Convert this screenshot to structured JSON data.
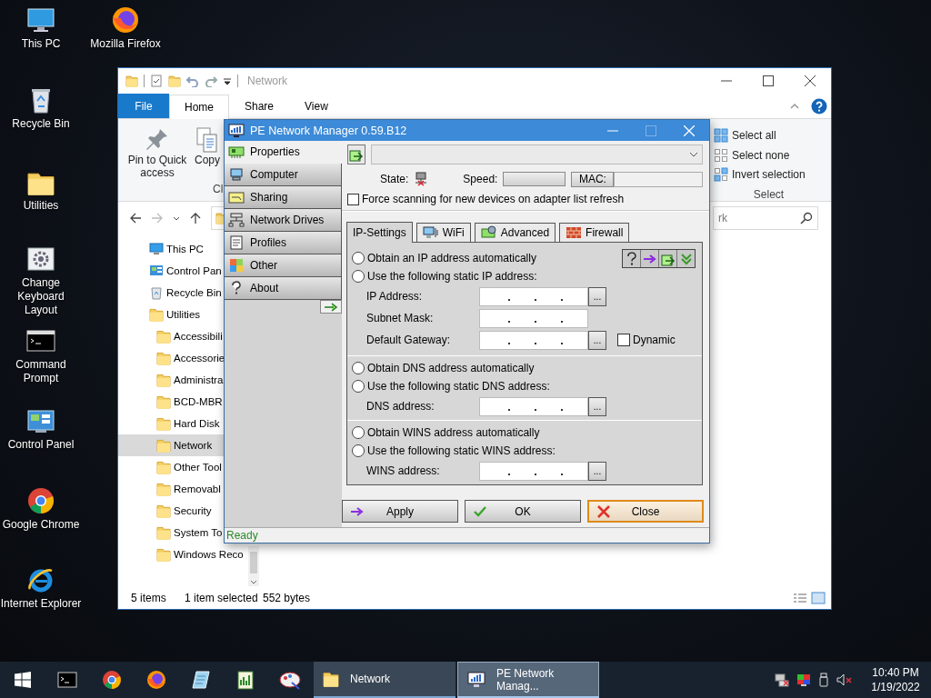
{
  "desktop": {
    "icons": [
      {
        "label": "This PC",
        "kind": "pc"
      },
      {
        "label": "Mozilla Firefox",
        "kind": "firefox"
      },
      {
        "label": "Recycle Bin",
        "kind": "recycle"
      },
      {
        "label": "Utilities",
        "kind": "folder"
      },
      {
        "label": "Change Keyboard Layout",
        "kind": "keyboard"
      },
      {
        "label": "Command Prompt",
        "kind": "cmd"
      },
      {
        "label": "Control Panel",
        "kind": "control"
      },
      {
        "label": "Google Chrome",
        "kind": "chrome"
      },
      {
        "label": "Internet Explorer",
        "kind": "ie"
      }
    ]
  },
  "explorer": {
    "title": "Network",
    "ribbon_tabs": [
      {
        "label": "File",
        "kind": "file",
        "selected": false
      },
      {
        "label": "Home",
        "kind": "tab",
        "selected": true
      },
      {
        "label": "Share",
        "kind": "tab",
        "selected": false
      },
      {
        "label": "View",
        "kind": "tab",
        "selected": false
      }
    ],
    "clipboard_commands": [
      {
        "label": "Pin to Quick access",
        "kind": "pin"
      },
      {
        "label": "Copy",
        "kind": "copy"
      }
    ],
    "clipboard_group": "Cl",
    "select_commands": [
      {
        "label": "Select all",
        "kind": "all"
      },
      {
        "label": "Select none",
        "kind": "none"
      },
      {
        "label": "Invert selection",
        "kind": "invert"
      }
    ],
    "select_group": "Select",
    "search": {
      "placeholder": "rk"
    },
    "nav_tree": [
      {
        "label": "This PC",
        "kind": "pc",
        "selected": false
      },
      {
        "label": "Control Pan",
        "kind": "control",
        "selected": false
      },
      {
        "label": "Recycle Bin",
        "kind": "recycle",
        "selected": false
      },
      {
        "label": "Utilities",
        "kind": "folder",
        "selected": false,
        "children": [
          {
            "label": "Accessibili",
            "kind": "folder",
            "selected": false
          },
          {
            "label": "Accessorie",
            "kind": "folder",
            "selected": false
          },
          {
            "label": "Administra",
            "kind": "folder",
            "selected": false
          },
          {
            "label": "BCD-MBR",
            "kind": "folder",
            "selected": false
          },
          {
            "label": "Hard Disk",
            "kind": "folder",
            "selected": false
          },
          {
            "label": "Network",
            "kind": "folder",
            "selected": true
          },
          {
            "label": "Other Tool",
            "kind": "folder",
            "selected": false
          },
          {
            "label": "Removabl",
            "kind": "folder",
            "selected": false
          },
          {
            "label": "Security",
            "kind": "folder",
            "selected": false
          },
          {
            "label": "System To",
            "kind": "folder",
            "selected": false
          },
          {
            "label": "Windows Reco",
            "kind": "folder",
            "selected": false
          }
        ]
      }
    ],
    "status": [
      "5 items",
      "1 item selected",
      "552 bytes"
    ]
  },
  "dialog": {
    "title": "PE Network Manager 0.59.B12",
    "sidebar": [
      {
        "label": "Properties",
        "kind": "properties",
        "selected": true
      },
      {
        "label": "Computer",
        "kind": "computer",
        "selected": false
      },
      {
        "label": "Sharing",
        "kind": "sharing",
        "selected": false
      },
      {
        "label": "Network Drives",
        "kind": "drives",
        "selected": false
      },
      {
        "label": "Profiles",
        "kind": "profiles",
        "selected": false
      },
      {
        "label": "Other",
        "kind": "other",
        "selected": false
      },
      {
        "label": "About",
        "kind": "about",
        "selected": false
      }
    ],
    "state_label": "State:",
    "speed_label": "Speed:",
    "mac_label": "MAC:",
    "force_scan": {
      "label": "Force scanning for new devices on adapter list refresh",
      "checked": false
    },
    "tabs": [
      {
        "label": "IP-Settings",
        "kind": "plain",
        "selected": true
      },
      {
        "label": "WiFi",
        "kind": "wifi",
        "selected": false
      },
      {
        "label": "Advanced",
        "kind": "advanced",
        "selected": false
      },
      {
        "label": "Firewall",
        "kind": "firewall",
        "selected": false
      }
    ],
    "sections": [
      {
        "radios": [
          {
            "label": "Obtain an IP address automatically",
            "selected": false
          },
          {
            "label": "Use the following static IP address:",
            "selected": false
          }
        ],
        "fields": [
          {
            "label": "IP Address:",
            "browse": "..."
          },
          {
            "label": "Subnet Mask:"
          },
          {
            "label": "Default Gateway:",
            "browse": "...",
            "option": {
              "label": "Dynamic",
              "checked": false
            }
          }
        ]
      },
      {
        "radios": [
          {
            "label": "Obtain DNS address automatically",
            "selected": false
          },
          {
            "label": "Use the following static DNS address:",
            "selected": false
          }
        ],
        "fields": [
          {
            "label": "DNS address:",
            "browse": "..."
          }
        ]
      },
      {
        "radios": [
          {
            "label": "Obtain WINS address automatically",
            "selected": false
          },
          {
            "label": "Use the following static WINS address:",
            "selected": false
          }
        ],
        "fields": [
          {
            "label": "WINS address:",
            "browse": "..."
          }
        ]
      }
    ],
    "buttons": [
      {
        "label": "Apply",
        "kind": "apply",
        "default": false
      },
      {
        "label": "OK",
        "kind": "ok",
        "default": false
      },
      {
        "label": "Close",
        "kind": "close",
        "default": true
      }
    ],
    "status": "Ready"
  },
  "taskbar": {
    "tasks": [
      {
        "label": "Network",
        "kind": "folder",
        "selected": false
      },
      {
        "label": "PE Network Manag...",
        "kind": "netman",
        "selected": true
      }
    ],
    "time": "10:40 PM",
    "date": "1/19/2022"
  }
}
